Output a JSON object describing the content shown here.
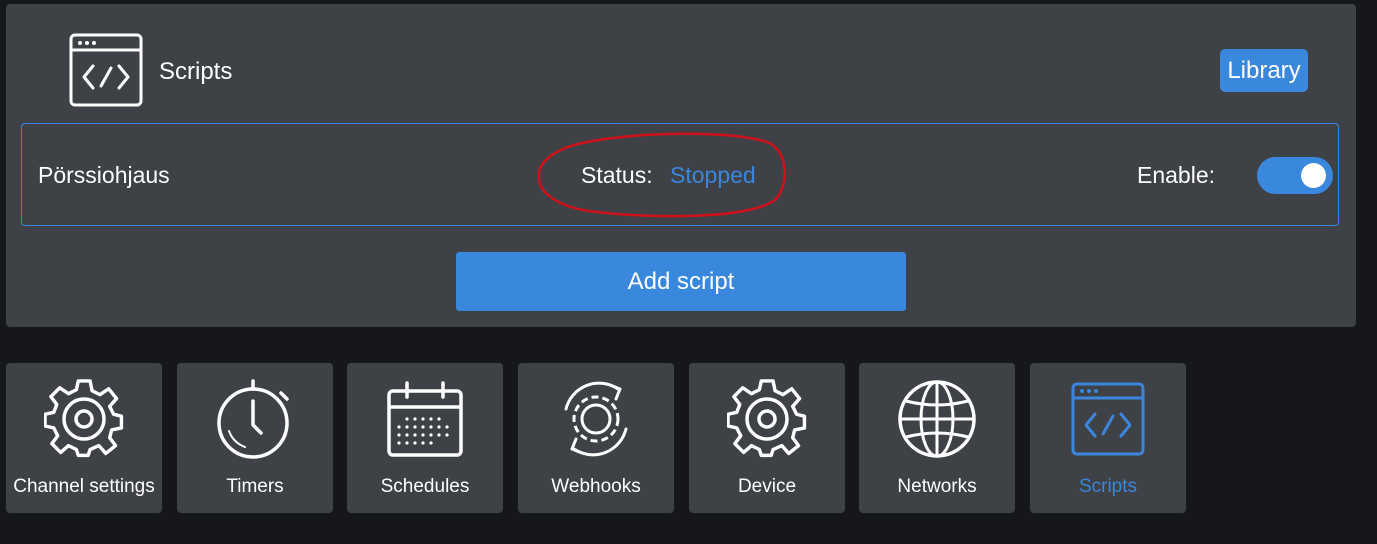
{
  "header": {
    "title": "Scripts",
    "icon": "code-window-icon",
    "library_label": "Library"
  },
  "script": {
    "name": "Pörssiohjaus",
    "status_label": "Status:",
    "status_value": "Stopped",
    "enable_label": "Enable:",
    "enabled": true
  },
  "add_script_label": "Add script",
  "colors": {
    "accent": "#3a87de",
    "panel": "#3e4146",
    "background": "#16171a",
    "annotation": "#d0111a"
  },
  "nav": {
    "items": [
      {
        "label": "Channel settings",
        "icon": "gear-icon",
        "active": false
      },
      {
        "label": "Timers",
        "icon": "stopwatch-icon",
        "active": false
      },
      {
        "label": "Schedules",
        "icon": "calendar-icon",
        "active": false
      },
      {
        "label": "Webhooks",
        "icon": "webhook-gear-icon",
        "active": false
      },
      {
        "label": "Device",
        "icon": "gear-icon",
        "active": false
      },
      {
        "label": "Networks",
        "icon": "globe-icon",
        "active": false
      },
      {
        "label": "Scripts",
        "icon": "code-window-icon",
        "active": true
      }
    ]
  }
}
